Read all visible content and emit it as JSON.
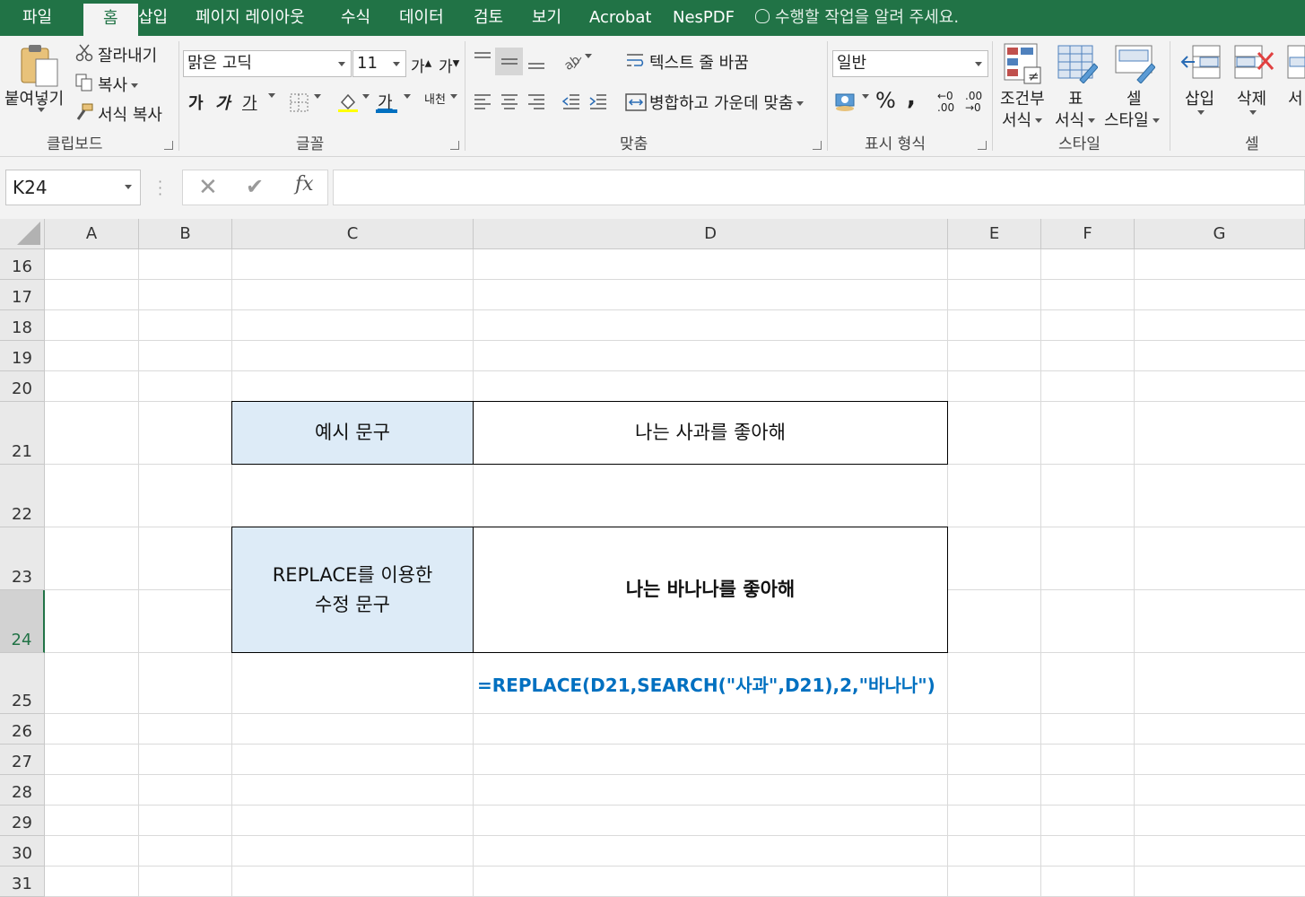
{
  "tabs": [
    "파일",
    "홈",
    "삽입",
    "페이지 레이아웃",
    "수식",
    "데이터",
    "검토",
    "보기",
    "Acrobat",
    "NesPDF"
  ],
  "active_tab": "홈",
  "tell_me": "수행할 작업을 알려 주세요.",
  "ribbon": {
    "clipboard": {
      "label": "클립보드",
      "paste": "붙여넣기",
      "cut": "잘라내기",
      "copy": "복사",
      "format_painter": "서식 복사"
    },
    "font": {
      "label": "글꼴",
      "name": "맑은 고딕",
      "size": "11",
      "grow": "가",
      "shrink": "가",
      "bold": "가",
      "italic": "가",
      "underline": "가",
      "font_color": "가",
      "phonetic": "내천"
    },
    "alignment": {
      "label": "맞춤",
      "wrap_text": "텍스트 줄 바꿈",
      "merge_center": "병합하고 가운데 맞춤"
    },
    "number": {
      "label": "표시 형식",
      "format": "일반",
      "percent": "%",
      "comma": ",",
      "inc_decimal": "←0 .00",
      "dec_decimal": ".00 →0"
    },
    "styles": {
      "label": "스타일",
      "conditional_1": "조건부",
      "conditional_2": "서식",
      "table_1": "표",
      "table_2": "서식",
      "cell_1": "셀",
      "cell_2": "스타일"
    },
    "cells": {
      "label": "셀",
      "insert": "삽입",
      "delete": "삭제",
      "format": "서"
    }
  },
  "formula_bar": {
    "name_box": "K24",
    "fx": "fx",
    "value": ""
  },
  "columns": [
    "A",
    "B",
    "C",
    "D",
    "E",
    "F",
    "G"
  ],
  "rows": [
    "16",
    "17",
    "18",
    "19",
    "20",
    "21",
    "22",
    "23",
    "24",
    "25",
    "26",
    "27",
    "28",
    "29",
    "30",
    "31"
  ],
  "selected_row": "24",
  "cells": {
    "c21": "예시 문구",
    "d21": "나는 사과를 좋아해",
    "c23_line1": "REPLACE를 이용한",
    "c23_line2": "수정 문구",
    "d23": "나는 바나나를 좋아해",
    "d25": "=REPLACE(D21,SEARCH(\"사과\",D21),2,\"바나나\")"
  },
  "colors": {
    "accent": "#217346",
    "label_fill": "#ddebf7",
    "formula_text": "#0070c0"
  }
}
